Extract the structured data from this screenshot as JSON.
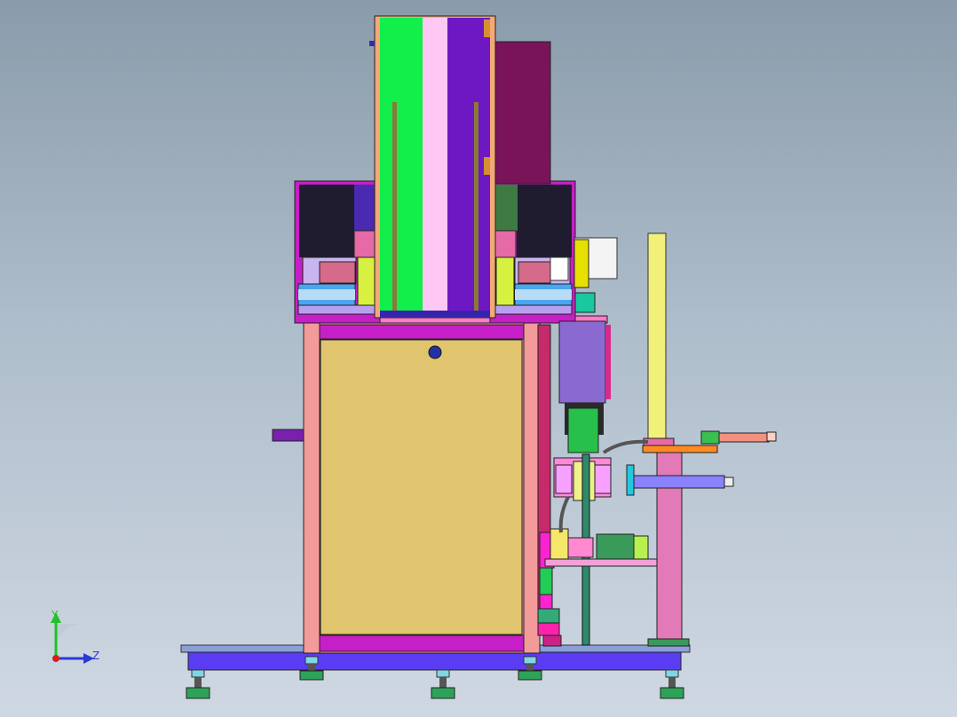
{
  "view": {
    "background_top": "#8a9bab",
    "background_bottom": "#cfd8e2"
  },
  "triad": {
    "y_label": "Y",
    "z_label": "Z",
    "y_color": "#22c02a",
    "z_color": "#2a3ad8",
    "origin_color": "#d81e1e"
  },
  "palette": {
    "cabinet_door": "#e0c56e",
    "frame_pink": "#f39a9a",
    "frame_magenta": "#c71fc7",
    "base_blue": "#5a3cf2",
    "column_green": "#12ee4a",
    "column_lightpink": "#ffc8f4",
    "column_purple": "#6e18c4",
    "tower_maroon": "#7a1459",
    "motor_green": "#3a9a5a",
    "post_pink": "#e37ab8",
    "rod_yellow": "#f0f07a"
  }
}
